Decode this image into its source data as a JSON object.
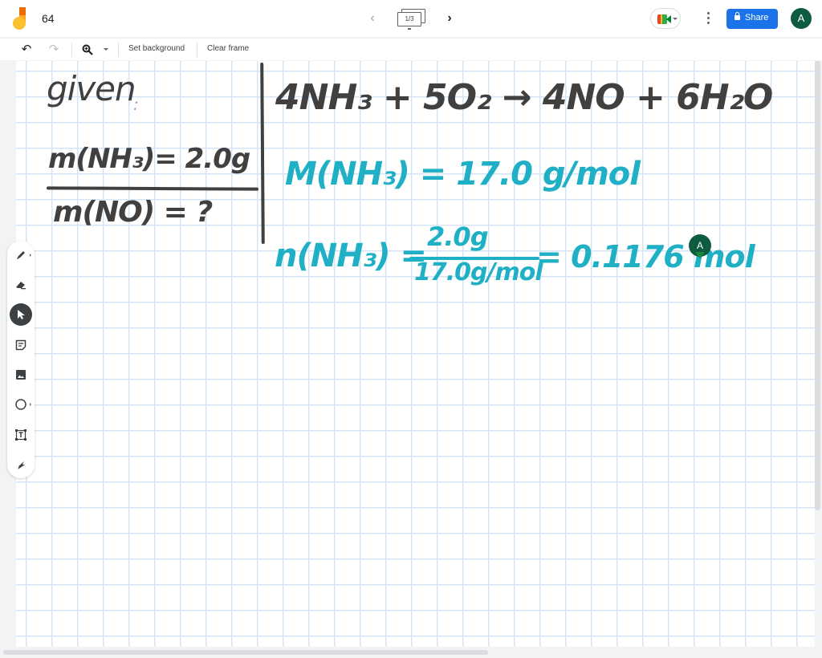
{
  "app": {
    "title": "64",
    "logo_icon": "jamboard-logo-icon"
  },
  "frame_nav": {
    "prev_icon": "chevron-left-icon",
    "next_icon": "chevron-right-icon",
    "counter": "1/3",
    "prev_glyph": "‹",
    "next_glyph": "›"
  },
  "header_actions": {
    "meet_icon": "google-meet-icon",
    "more_icon": "more-vert-icon",
    "share_label": "Share",
    "share_icon": "lock-icon",
    "avatar_initial": "A",
    "accent_color": "#1a73e8",
    "avatar_color": "#0d5c3f"
  },
  "toolbar": {
    "undo_glyph": "↶",
    "redo_glyph": "↷",
    "zoom_glyph": "🔍︎",
    "set_background_label": "Set background",
    "clear_frame_label": "Clear frame"
  },
  "tools": [
    {
      "name": "pen",
      "icon": "pen-icon",
      "has_submenu": true,
      "active": false
    },
    {
      "name": "eraser",
      "icon": "eraser-icon",
      "has_submenu": false,
      "active": false
    },
    {
      "name": "select",
      "icon": "cursor-arrow-icon",
      "has_submenu": false,
      "active": true
    },
    {
      "name": "sticky-note",
      "icon": "sticky-note-icon",
      "has_submenu": false,
      "active": false
    },
    {
      "name": "image",
      "icon": "image-icon",
      "has_submenu": false,
      "active": false
    },
    {
      "name": "circle",
      "icon": "circle-shape-icon",
      "has_submenu": true,
      "active": false
    },
    {
      "name": "text-box",
      "icon": "text-box-icon",
      "has_submenu": false,
      "active": false
    },
    {
      "name": "laser",
      "icon": "laser-icon",
      "has_submenu": false,
      "active": false
    }
  ],
  "canvas": {
    "background": "grid",
    "ink_colors": {
      "dark": "#404040",
      "teal": "#1fb0c6"
    },
    "given_label": "given",
    "given_colon": ":",
    "given_mass": "m(NH₃)= 2.0g",
    "unknown_mass": "m(NO) = ?",
    "equation": "4NH₃ + 5O₂ → 4NO + 6H₂O",
    "molar_mass": "M(NH₃) = 17.0 g/mol",
    "moles_lhs": "n(NH₃) =",
    "fraction_numerator": "2.0g",
    "fraction_denominator": "17.0g/mol",
    "moles_rhs": "= 0.1176 mol",
    "collaborator_cursor": "A"
  }
}
